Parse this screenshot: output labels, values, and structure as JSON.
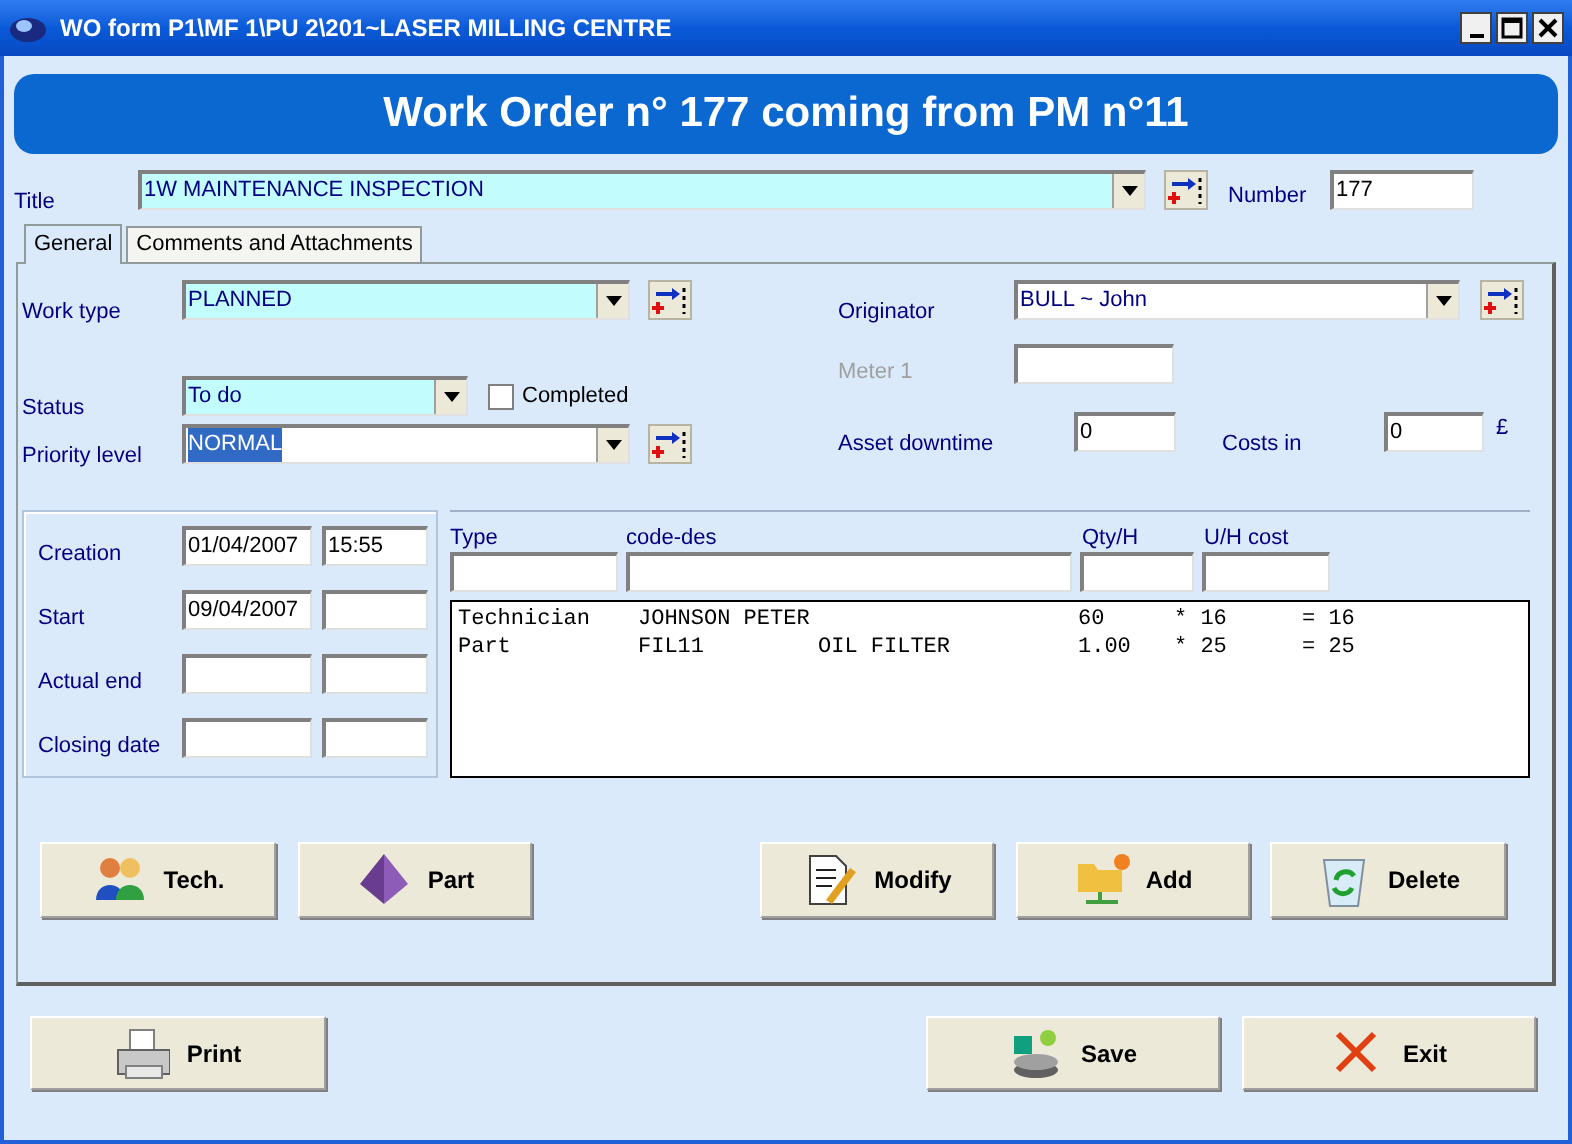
{
  "window": {
    "title": "WO form P1\\MF 1\\PU 2\\201~LASER MILLING CENTRE"
  },
  "banner": "Work Order n° 177 coming from PM n°11",
  "title_field": {
    "label": "Title",
    "value": "1W MAINTENANCE INSPECTION",
    "highlighted": true
  },
  "number_field": {
    "label": "Number",
    "value": "177"
  },
  "tabs": [
    {
      "label": "General",
      "selected": true
    },
    {
      "label": "Comments and Attachments",
      "selected": false
    }
  ],
  "work_type": {
    "label": "Work type",
    "value": "PLANNED",
    "highlighted": true
  },
  "status": {
    "label": "Status",
    "value": "To do",
    "highlighted": true
  },
  "completed": {
    "label": "Completed",
    "checked": false
  },
  "priority": {
    "label": "Priority level",
    "value": "NORMAL",
    "highlighted": false,
    "text_selected": true
  },
  "originator": {
    "label": "Originator",
    "value": "BULL ~ John",
    "highlighted": false
  },
  "meter": {
    "label": "Meter 1",
    "disabled": true
  },
  "asset_downtime": {
    "label": "Asset downtime",
    "value": "0"
  },
  "costs": {
    "label": "Costs in",
    "value": "0",
    "currency": "£"
  },
  "dates": [
    {
      "label": "Creation",
      "date": "01/04/2007",
      "time": "15:55"
    },
    {
      "label": "Start",
      "date": "09/04/2007"
    },
    {
      "label": "Actual end"
    },
    {
      "label": "Closing date"
    }
  ],
  "entry_columns": [
    "Type",
    "code-des",
    "Qty/H",
    "U/H cost"
  ],
  "lines": [
    {
      "type": "Technician",
      "code": "JOHNSON PETER",
      "qty": "60",
      "unit_cost": "* 16",
      "total": "= 16"
    },
    {
      "type": "Part",
      "code": "FIL11",
      "description": "OIL FILTER",
      "qty": "1.00",
      "unit_cost": "* 25",
      "total": "= 25"
    }
  ],
  "panel_buttons": [
    {
      "label": "Tech.",
      "kind": "people"
    },
    {
      "label": "Part",
      "kind": "pyramid"
    },
    {
      "label": "Modify",
      "kind": "document"
    },
    {
      "label": "Add",
      "kind": "folder"
    },
    {
      "label": "Delete",
      "kind": "bin"
    }
  ],
  "footer_buttons": [
    {
      "label": "Print",
      "kind": "printer"
    },
    {
      "label": "Save",
      "kind": "disk"
    },
    {
      "label": "Exit",
      "kind": "cross"
    }
  ]
}
